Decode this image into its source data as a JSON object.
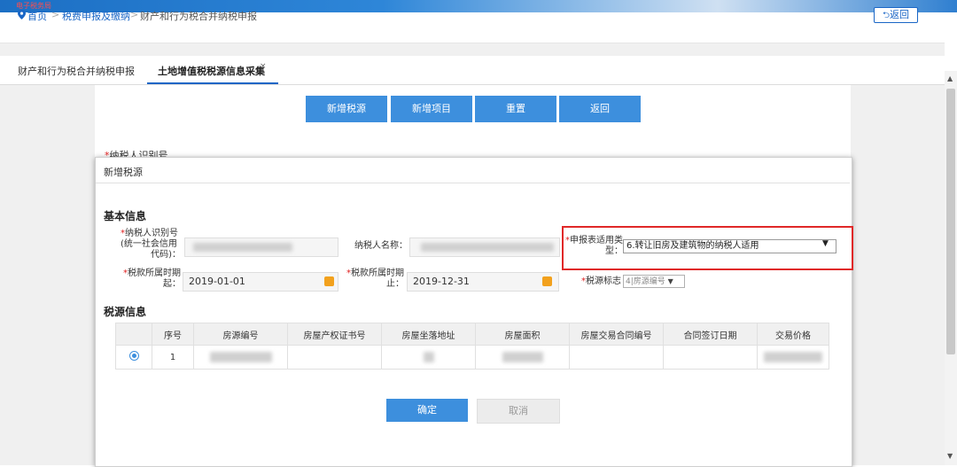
{
  "header": {
    "brand": "电子税务局"
  },
  "breadcrumb": {
    "home": "首页",
    "sep": ">",
    "level2": "税费申报及缴纳",
    "level3": "财产和行为税合并纳税申报",
    "back": "返回"
  },
  "tabs": [
    {
      "label": "财产和行为税合并纳税申报"
    },
    {
      "label": "土地增值税税源信息采集",
      "close": "×"
    }
  ],
  "toolbar": {
    "add_source": "新增税源",
    "add_project": "新增项目",
    "reset": "重置",
    "back": "返回"
  },
  "behind": {
    "taxpayer_id_label": "纳税人识别号"
  },
  "modal": {
    "title": "新增税源",
    "section_basic": "基本信息",
    "taxpayer_id_label_1": "纳税人识别号",
    "taxpayer_id_label_2": "(统一社会信用",
    "taxpayer_id_label_3": "代码)：",
    "taxpayer_name_label": "纳税人名称：",
    "form_type_label_1": "申报表适用类",
    "form_type_label_2": "型：",
    "form_type_value": "6.转让旧房及建筑物的纳税人适用",
    "period_start_label_1": "税款所属时期",
    "period_start_label_2": "起：",
    "period_start_value": "2019-01-01",
    "period_end_label_1": "税款所属时期",
    "period_end_label_2": "止：",
    "period_end_value": "2019-12-31",
    "source_flag_label": "税源标志",
    "source_flag_value": "4|房源编号",
    "section_source": "税源信息",
    "table_headers": [
      "",
      "序号",
      "房源编号",
      "房屋产权证书号",
      "房屋坐落地址",
      "房屋面积",
      "房屋交易合同编号",
      "合同签订日期",
      "交易价格"
    ],
    "row_index": "1",
    "confirm": "确定",
    "cancel": "取消"
  },
  "colors": {
    "primary": "#3d8fdd",
    "link": "#1a66c6",
    "highlight": "#e02828",
    "required": "#e02020"
  }
}
